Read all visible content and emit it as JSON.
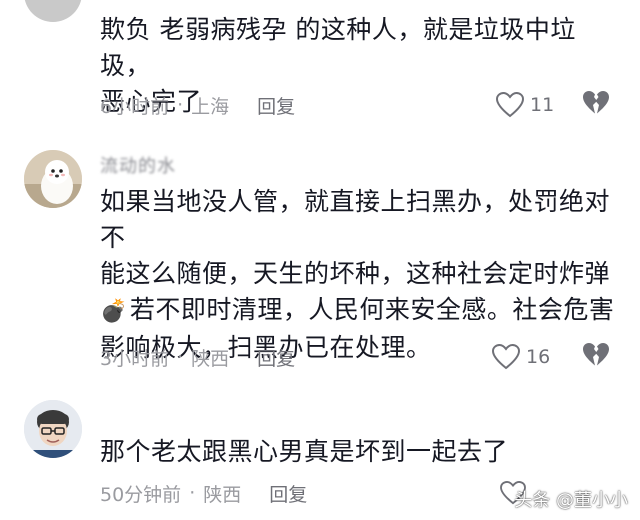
{
  "comments": [
    {
      "username": "",
      "lines": [
        "欺负 老弱病残孕 的这种人，就是垃圾中垃圾，",
        "恶心完了"
      ],
      "time": "6小时前",
      "location": "上海",
      "reply_label": "回复",
      "likes": "11"
    },
    {
      "username": "流动的水",
      "lines": [
        "如果当地没人管，就直接上扫黑办，处罚绝对不",
        "能这么随便，天生的坏种，这种社会定时炸弹",
        "若不即时清理，人民何来安全感。社会危害",
        "影响极大，扫黑办已在处理。"
      ],
      "emoji": "💣",
      "time": "3小时前",
      "location": "陕西",
      "reply_label": "回复",
      "likes": "16"
    },
    {
      "username": "",
      "lines": [
        "那个老太跟黑心男真是坏到一起去了"
      ],
      "time": "50分钟前",
      "location": "陕西",
      "reply_label": "回复",
      "likes": ""
    }
  ],
  "watermark": "头条 @董小小",
  "icons": {
    "like": "heart-outline-icon",
    "dislike": "broken-heart-icon",
    "bomb": "bomb-emoji-icon"
  },
  "colors": {
    "text": "#161823",
    "meta": "#9a9ba0",
    "icon": "#6f7077"
  }
}
